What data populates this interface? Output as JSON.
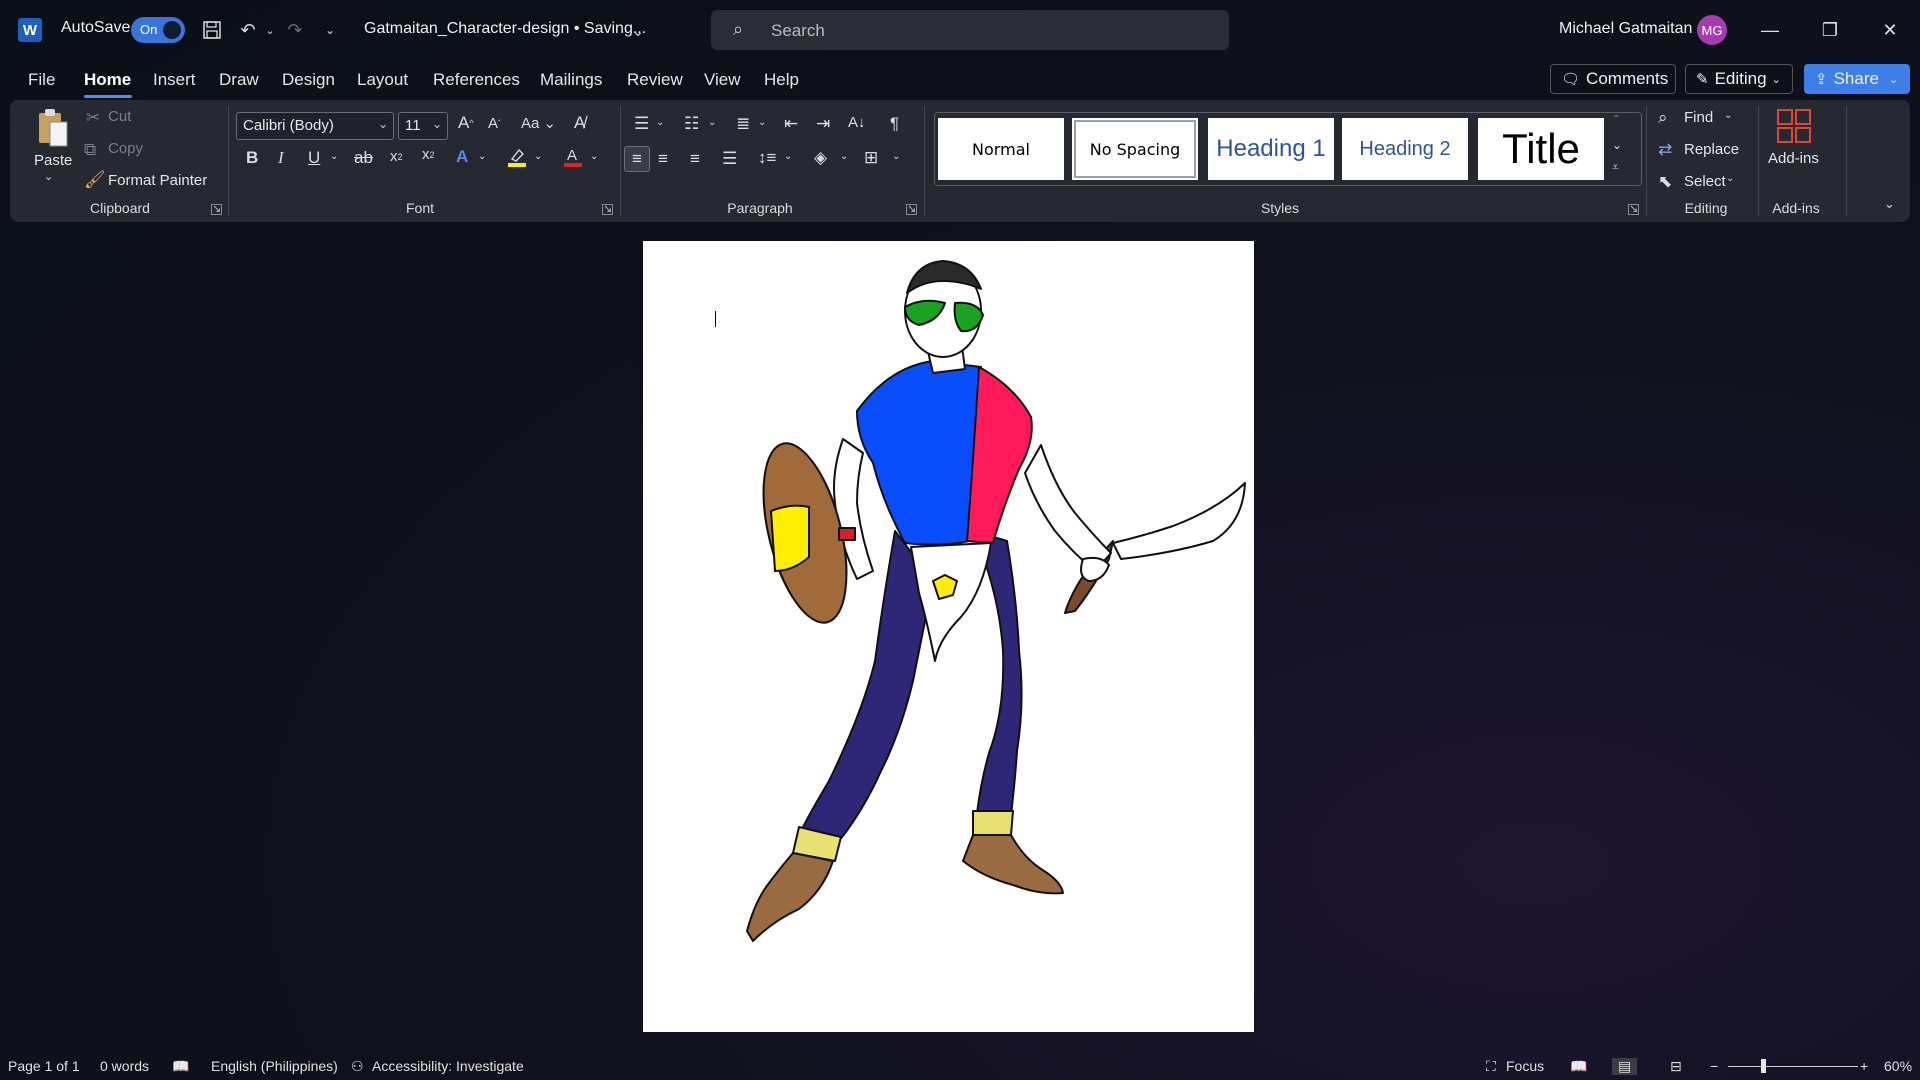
{
  "titlebar": {
    "app_icon": "word-icon",
    "autosave_label": "AutoSave",
    "autosave_state": "On",
    "document_title": "Gatmaitan_Character-design • Saving...",
    "search_placeholder": "Search",
    "user_name": "Michael Gatmaitan",
    "user_initials": "MG"
  },
  "menu": {
    "tabs": [
      "File",
      "Home",
      "Insert",
      "Draw",
      "Design",
      "Layout",
      "References",
      "Mailings",
      "Review",
      "View",
      "Help"
    ],
    "active_tab": "Home",
    "comments_label": "Comments",
    "editing_label": "Editing",
    "share_label": "Share"
  },
  "ribbon": {
    "clipboard": {
      "label": "Clipboard",
      "paste": "Paste",
      "cut": "Cut",
      "copy": "Copy",
      "format_painter": "Format Painter"
    },
    "font": {
      "label": "Font",
      "font_name": "Calibri (Body)",
      "font_size": "11"
    },
    "paragraph": {
      "label": "Paragraph"
    },
    "styles": {
      "label": "Styles",
      "items": [
        "Normal",
        "No Spacing",
        "Heading 1",
        "Heading 2",
        "Title"
      ]
    },
    "editing": {
      "label": "Editing",
      "find": "Find",
      "replace": "Replace",
      "select": "Select"
    },
    "addins": {
      "label": "Add-ins",
      "button": "Add-ins"
    }
  },
  "statusbar": {
    "page": "Page 1 of 1",
    "words": "0 words",
    "language": "English (Philippines)",
    "accessibility": "Accessibility: Investigate",
    "focus": "Focus",
    "zoom": "60%"
  },
  "colors": {
    "accent": "#4f8df5",
    "shirt_blue": "#0a4dff",
    "shirt_red": "#ff1a5a",
    "pants": "#2e2778",
    "sun": "#ffee00",
    "shield": "#a06a3a"
  }
}
